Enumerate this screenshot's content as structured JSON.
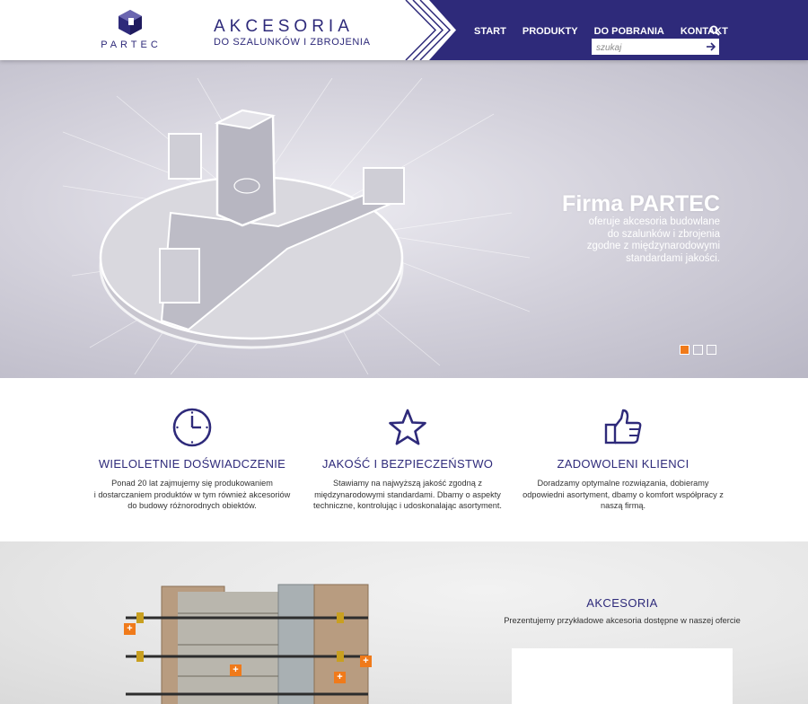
{
  "header": {
    "logo_text": "PARTEC",
    "tagline_main": "AKCESORIA",
    "tagline_sub": "DO SZALUNKÓW I ZBROJENIA",
    "nav": [
      "START",
      "PRODUKTY",
      "DO POBRANIA",
      "KONTAKT"
    ],
    "search_placeholder": "szukaj",
    "colors": {
      "brand": "#2e2a7a",
      "accent": "#f07a1a"
    }
  },
  "hero": {
    "title": "Firma PARTEC",
    "text_lines": [
      "oferuje akcesoria budowlane",
      "do szalunków i zbrojenia",
      "zgodne z międzynarodowymi",
      "standardami jakości."
    ],
    "slides": 3,
    "active_slide": 1
  },
  "features": [
    {
      "icon": "clock-icon",
      "title": "WIELOLETNIE DOŚWIADCZENIE",
      "text_lines": [
        "Ponad 20 lat zajmujemy się produkowaniem",
        "i dostarczaniem produktów w tym również akcesoriów",
        "do budowy różnorodnych obiektów."
      ]
    },
    {
      "icon": "star-icon",
      "title": "JAKOŚĆ I BEZPIECZEŃSTWO",
      "text_lines": [
        "Stawiamy na najwyższą jakość zgodną z",
        "międzynarodowymi standardami. Dbamy o aspekty",
        "techniczne, kontrolując i udoskonalając asortyment."
      ]
    },
    {
      "icon": "thumbs-up-icon",
      "title": "ZADOWOLENI KLIENCI",
      "text_lines": [
        "Doradzamy optymalne rozwiązania, dobieramy",
        "odpowiedni asortyment, dbamy o komfort współpracy z",
        "naszą firmą."
      ]
    }
  ],
  "accessories": {
    "title": "AKCESORIA",
    "text": "Prezentujemy przykładowe akcesoria dostępne w naszej ofercie",
    "hotspot_label": "+"
  }
}
